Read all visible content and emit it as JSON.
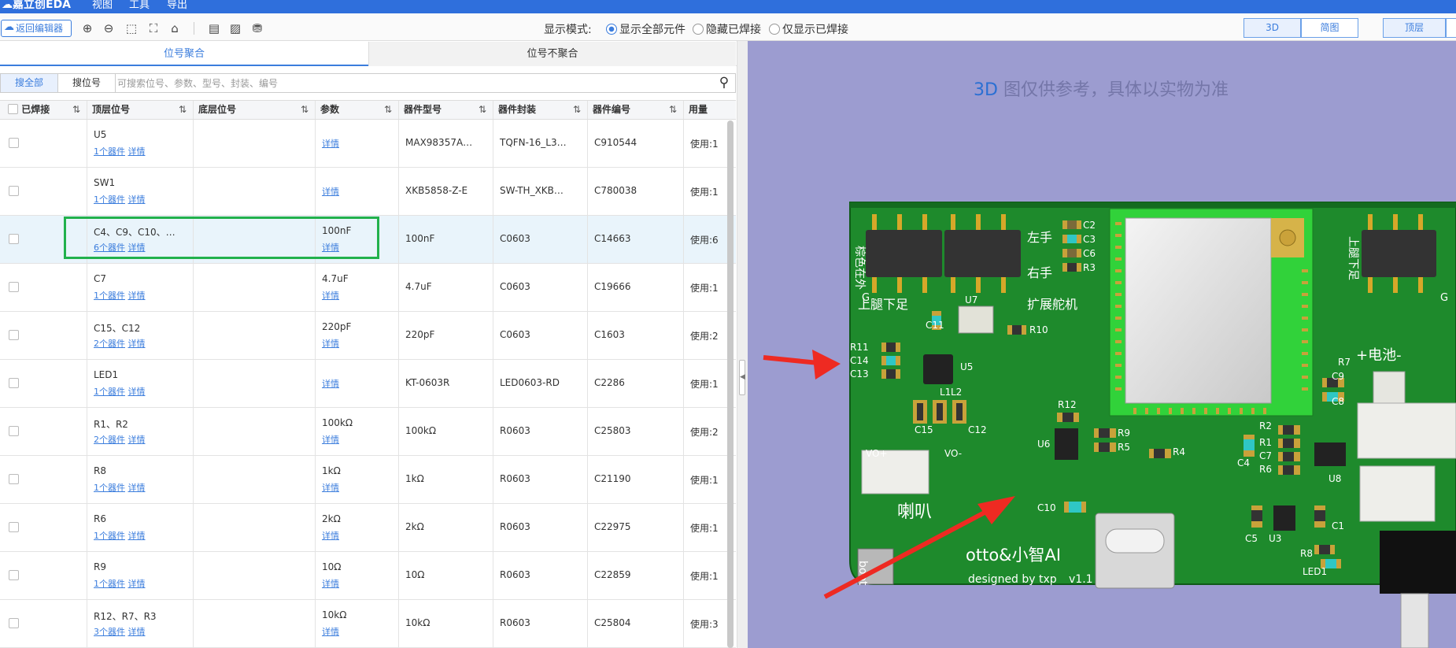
{
  "menubar": {
    "logo": "嘉立创EDA",
    "items": [
      "视图",
      "工具",
      "导出"
    ]
  },
  "toolbar": {
    "back_label": "返回编辑器",
    "mode_label": "显示模式:",
    "modes": [
      "显示全部元件",
      "隐藏已焊接",
      "仅显示已焊接"
    ],
    "view_buttons": [
      "3D",
      "简图"
    ],
    "layer_button": "顶层"
  },
  "tabs": [
    "位号聚合",
    "位号不聚合"
  ],
  "search": {
    "all_label": "搜全部",
    "ref_label": "搜位号",
    "placeholder": "可搜索位号、参数、型号、封装、编号"
  },
  "columns": [
    "已焊接",
    "顶层位号",
    "底层位号",
    "参数",
    "器件型号",
    "器件封装",
    "器件编号",
    "用量"
  ],
  "rows": [
    {
      "ref": "U5",
      "count": "1个器件",
      "detail": "详情",
      "param": "",
      "param_detail": "详情",
      "model": "MAX98357A…",
      "pkg": "TQFN-16_L3…",
      "code": "C910544",
      "usage": "使用:1"
    },
    {
      "ref": "SW1",
      "count": "1个器件",
      "detail": "详情",
      "param": "",
      "param_detail": "详情",
      "model": "XKB5858-Z-E",
      "pkg": "SW-TH_XKB…",
      "code": "C780038",
      "usage": "使用:1"
    },
    {
      "ref": "C4、C9、C10、…",
      "count": "6个器件",
      "detail": "详情",
      "param": "100nF",
      "param_detail": "详情",
      "model": "100nF",
      "pkg": "C0603",
      "code": "C14663",
      "usage": "使用:6"
    },
    {
      "ref": "C7",
      "count": "1个器件",
      "detail": "详情",
      "param": "4.7uF",
      "param_detail": "详情",
      "model": "4.7uF",
      "pkg": "C0603",
      "code": "C19666",
      "usage": "使用:1"
    },
    {
      "ref": "C15、C12",
      "count": "2个器件",
      "detail": "详情",
      "param": "220pF",
      "param_detail": "详情",
      "model": "220pF",
      "pkg": "C0603",
      "code": "C1603",
      "usage": "使用:2"
    },
    {
      "ref": "LED1",
      "count": "1个器件",
      "detail": "详情",
      "param": "",
      "param_detail": "详情",
      "model": "KT-0603R",
      "pkg": "LED0603-RD",
      "code": "C2286",
      "usage": "使用:1"
    },
    {
      "ref": "R1、R2",
      "count": "2个器件",
      "detail": "详情",
      "param": "100kΩ",
      "param_detail": "详情",
      "model": "100kΩ",
      "pkg": "R0603",
      "code": "C25803",
      "usage": "使用:2"
    },
    {
      "ref": "R8",
      "count": "1个器件",
      "detail": "详情",
      "param": "1kΩ",
      "param_detail": "详情",
      "model": "1kΩ",
      "pkg": "R0603",
      "code": "C21190",
      "usage": "使用:1"
    },
    {
      "ref": "R6",
      "count": "1个器件",
      "detail": "详情",
      "param": "2kΩ",
      "param_detail": "详情",
      "model": "2kΩ",
      "pkg": "R0603",
      "code": "C22975",
      "usage": "使用:1"
    },
    {
      "ref": "R9",
      "count": "1个器件",
      "detail": "详情",
      "param": "10Ω",
      "param_detail": "详情",
      "model": "10Ω",
      "pkg": "R0603",
      "code": "C22859",
      "usage": "使用:1"
    },
    {
      "ref": "R12、R7、R3",
      "count": "3个器件",
      "detail": "详情",
      "param": "10kΩ",
      "param_detail": "详情",
      "model": "10kΩ",
      "pkg": "R0603",
      "code": "C25804",
      "usage": "使用:3"
    }
  ],
  "view3d": {
    "note_prefix": "3D",
    "note_text": "图仅供参考，具体以实物为准",
    "board": {
      "title": "otto&小智AI",
      "subtitle": "designed by txp",
      "version": "v1.1",
      "labels": {
        "zuoshou": "左手",
        "youshou": "右手",
        "shangtui_left": "上腿下足",
        "kuozhan": "扩展舵机",
        "dianchi": "+电池-",
        "laba": "喇叭",
        "vo_plus": "VO+",
        "vo_minus": "VO-",
        "boot": "boot",
        "g": "G",
        "zongse": "棕色在外",
        "shangtui_right": "上腿下足"
      },
      "designators": [
        "C2",
        "C3",
        "C6",
        "R3",
        "U7",
        "C11",
        "R10",
        "R11",
        "C14",
        "C13",
        "U5",
        "L2",
        "L1",
        "C15",
        "C12",
        "R12",
        "R9",
        "R5",
        "U6",
        "R4",
        "C10",
        "R2",
        "R1",
        "C4",
        "C7",
        "R6",
        "U8",
        "R7",
        "C9",
        "C8",
        "C5",
        "U3",
        "C1",
        "R8",
        "LED1"
      ]
    }
  }
}
